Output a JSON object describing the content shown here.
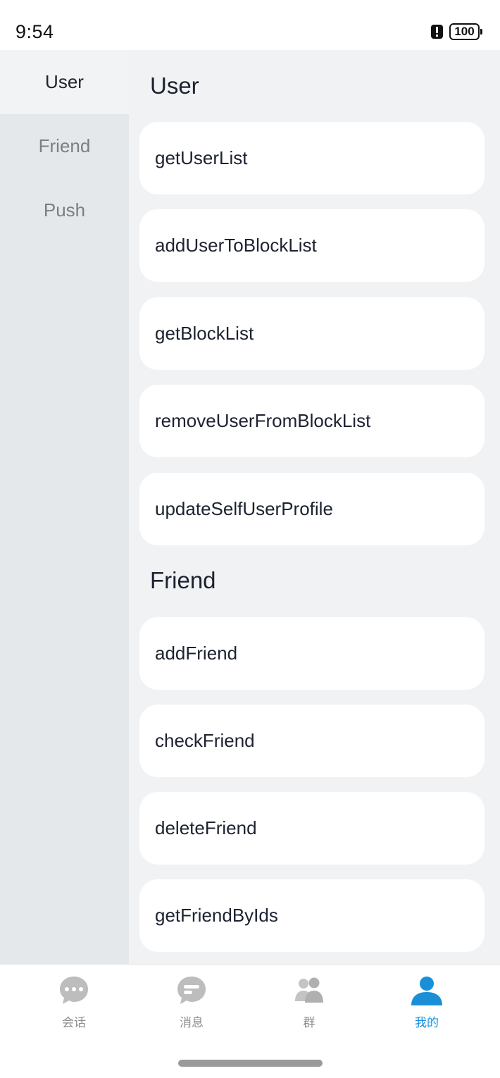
{
  "status_bar": {
    "time": "9:54",
    "battery": "100",
    "alert_icon": "alert-icon"
  },
  "sidebar": {
    "items": [
      {
        "label": "User",
        "active": true
      },
      {
        "label": "Friend",
        "active": false
      },
      {
        "label": "Push",
        "active": false
      }
    ]
  },
  "main": {
    "sections": [
      {
        "title": "User",
        "items": [
          "getUserList",
          "addUserToBlockList",
          "getBlockList",
          "removeUserFromBlockList",
          "updateSelfUserProfile"
        ]
      },
      {
        "title": "Friend",
        "items": [
          "addFriend",
          "checkFriend",
          "deleteFriend",
          "getFriendByIds"
        ]
      }
    ]
  },
  "tabbar": {
    "tabs": [
      {
        "label": "会话",
        "icon": "chat-bubble-icon",
        "active": false
      },
      {
        "label": "消息",
        "icon": "message-icon",
        "active": false
      },
      {
        "label": "群",
        "icon": "group-icon",
        "active": false
      },
      {
        "label": "我的",
        "icon": "person-icon",
        "active": true
      }
    ]
  },
  "colors": {
    "accent": "#1a8fd8",
    "inactive_tab": "#bdbdbd",
    "sidebar_bg": "#e5e8eb",
    "main_bg": "#f1f2f4"
  }
}
